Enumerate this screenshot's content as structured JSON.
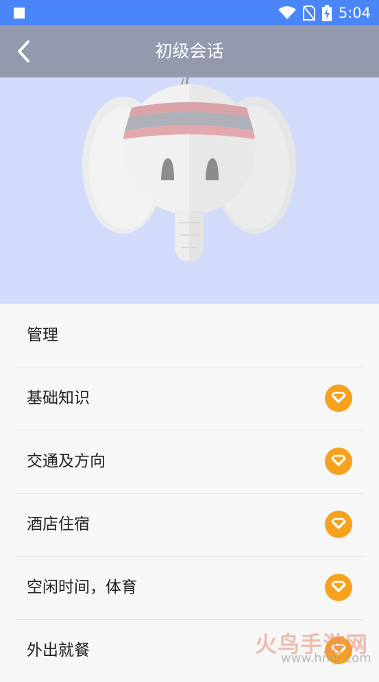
{
  "status_bar": {
    "time": "5:04"
  },
  "app_bar": {
    "title": "初级会话"
  },
  "list": {
    "items": [
      {
        "label": "管理",
        "badge": false
      },
      {
        "label": "基础知识",
        "badge": true
      },
      {
        "label": "交通及方向",
        "badge": true
      },
      {
        "label": "酒店住宿",
        "badge": true
      },
      {
        "label": "空闲时间，体育",
        "badge": true
      },
      {
        "label": "外出就餐",
        "badge": true
      }
    ]
  },
  "watermark": {
    "text": "火鸟手游网",
    "url": "www.hnqj.com"
  },
  "colors": {
    "status_bar": "#4A86F7",
    "app_bar": "#9499AE",
    "hero_bg": "#D3DBFB",
    "badge": "#F7A21F"
  }
}
